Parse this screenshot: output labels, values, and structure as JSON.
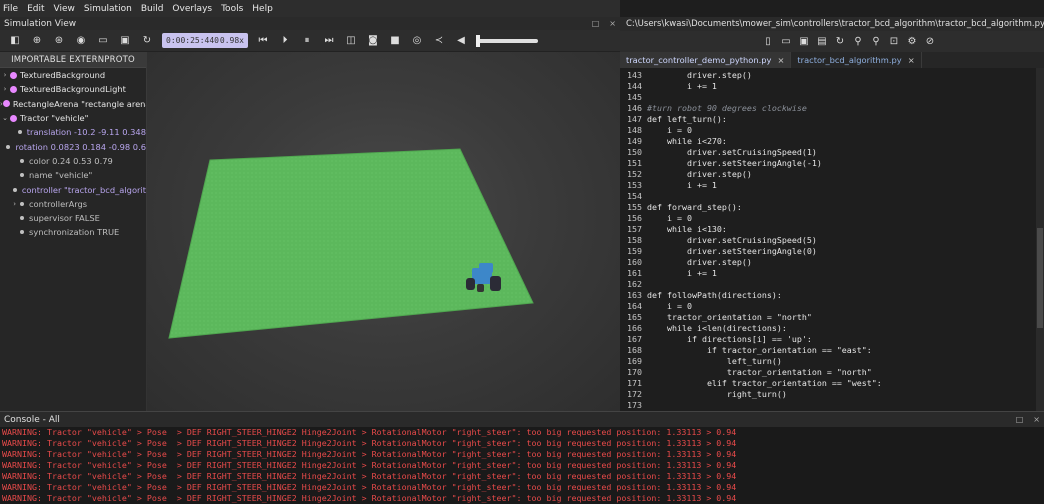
{
  "menubar": [
    "File",
    "Edit",
    "View",
    "Simulation",
    "Build",
    "Overlays",
    "Tools",
    "Help"
  ],
  "sim_view": {
    "title": "Simulation View",
    "time": "0:00:25:440",
    "speed": "0.98x",
    "win_buttons": [
      "□",
      "⨯"
    ]
  },
  "tree": {
    "header": "IMPORTABLE EXTERNPROTO",
    "items": [
      {
        "kind": "node",
        "arrow": "›",
        "text": "TexturedBackground"
      },
      {
        "kind": "node",
        "arrow": "›",
        "text": "TexturedBackgroundLight"
      },
      {
        "kind": "node",
        "arrow": "›",
        "text": "RectangleArena \"rectangle arena\""
      },
      {
        "kind": "node",
        "arrow": "⌄",
        "text": "Tractor \"vehicle\""
      },
      {
        "kind": "field",
        "text": "translation -10.2 -9.11 0.348",
        "purple": true
      },
      {
        "kind": "field",
        "text": "rotation 0.0823 0.184 -0.98 0.6",
        "purple": true
      },
      {
        "kind": "field",
        "text": "color 0.24 0.53 0.79",
        "purple": false
      },
      {
        "kind": "field",
        "text": "name \"vehicle\"",
        "purple": false
      },
      {
        "kind": "field",
        "text": "controller \"tractor_bcd_algorit",
        "purple": true
      },
      {
        "kind": "field",
        "arrow": "›",
        "text": "controllerArgs",
        "purple": false
      },
      {
        "kind": "field",
        "text": "supervisor FALSE",
        "purple": false
      },
      {
        "kind": "field",
        "text": "synchronization TRUE",
        "purple": false
      }
    ]
  },
  "editor": {
    "path": "C:\\Users\\kwasi\\Documents\\mower_sim\\controllers\\tractor_bcd_algorithm\\tractor_bcd_algorithm.py",
    "tabs": [
      {
        "label": "tractor_controller_demo_python.py",
        "active": true
      },
      {
        "label": "tractor_bcd_algorithm.py",
        "active": false
      }
    ],
    "tab_close": "×",
    "lines": [
      {
        "n": "143",
        "t": "        driver.step()"
      },
      {
        "n": "144",
        "t": "        i += 1"
      },
      {
        "n": "145",
        "t": ""
      },
      {
        "n": "146",
        "t": "#turn robot 90 degrees clockwise"
      },
      {
        "n": "147",
        "t": "def left_turn():"
      },
      {
        "n": "148",
        "t": "    i = 0"
      },
      {
        "n": "149",
        "t": "    while i<270:"
      },
      {
        "n": "150",
        "t": "        driver.setCruisingSpeed(1)"
      },
      {
        "n": "151",
        "t": "        driver.setSteeringAngle(-1)"
      },
      {
        "n": "152",
        "t": "        driver.step()"
      },
      {
        "n": "153",
        "t": "        i += 1"
      },
      {
        "n": "154",
        "t": ""
      },
      {
        "n": "155",
        "t": "def forward_step():"
      },
      {
        "n": "156",
        "t": "    i = 0"
      },
      {
        "n": "157",
        "t": "    while i<130:"
      },
      {
        "n": "158",
        "t": "        driver.setCruisingSpeed(5)"
      },
      {
        "n": "159",
        "t": "        driver.setSteeringAngle(0)"
      },
      {
        "n": "160",
        "t": "        driver.step()"
      },
      {
        "n": "161",
        "t": "        i += 1"
      },
      {
        "n": "162",
        "t": ""
      },
      {
        "n": "163",
        "t": "def followPath(directions):"
      },
      {
        "n": "164",
        "t": "    i = 0"
      },
      {
        "n": "165",
        "t": "    tractor_orientation = \"north\""
      },
      {
        "n": "166",
        "t": "    while i<len(directions):"
      },
      {
        "n": "167",
        "t": "        if directions[i] == 'up':"
      },
      {
        "n": "168",
        "t": "            if tractor_orientation == \"east\":"
      },
      {
        "n": "169",
        "t": "                left_turn()"
      },
      {
        "n": "170",
        "t": "                tractor_orientation = \"north\""
      },
      {
        "n": "171",
        "t": "            elif tractor_orientation == \"west\":"
      },
      {
        "n": "172",
        "t": "                right_turn()"
      },
      {
        "n": "173",
        "t": ""
      }
    ]
  },
  "console": {
    "title": "Console - All",
    "lines": [
      "WARNING: Tractor \"vehicle\" > Pose  > DEF RIGHT_STEER_HINGE2 Hinge2Joint > RotationalMotor \"right_steer\": too big requested position: 1.33113 > 0.94",
      "WARNING: Tractor \"vehicle\" > Pose  > DEF RIGHT_STEER_HINGE2 Hinge2Joint > RotationalMotor \"right_steer\": too big requested position: 1.33113 > 0.94",
      "WARNING: Tractor \"vehicle\" > Pose  > DEF RIGHT_STEER_HINGE2 Hinge2Joint > RotationalMotor \"right_steer\": too big requested position: 1.33113 > 0.94",
      "WARNING: Tractor \"vehicle\" > Pose  > DEF RIGHT_STEER_HINGE2 Hinge2Joint > RotationalMotor \"right_steer\": too big requested position: 1.33113 > 0.94",
      "WARNING: Tractor \"vehicle\" > Pose  > DEF RIGHT_STEER_HINGE2 Hinge2Joint > RotationalMotor \"right_steer\": too big requested position: 1.33113 > 0.94",
      "WARNING: Tractor \"vehicle\" > Pose  > DEF RIGHT_STEER_HINGE2 Hinge2Joint > RotationalMotor \"right_steer\": too big requested position: 1.33113 > 0.94",
      "WARNING: Tractor \"vehicle\" > Pose  > DEF RIGHT_STEER_HINGE2 Hinge2Joint > RotationalMotor \"right_steer\": too big requested position: 1.33113 > 0.94"
    ]
  },
  "colors": {
    "arena": "#5cb85c",
    "tractor": "#3d87c9",
    "warning": "#e84a4a",
    "time_box": "#c9c3ef"
  }
}
